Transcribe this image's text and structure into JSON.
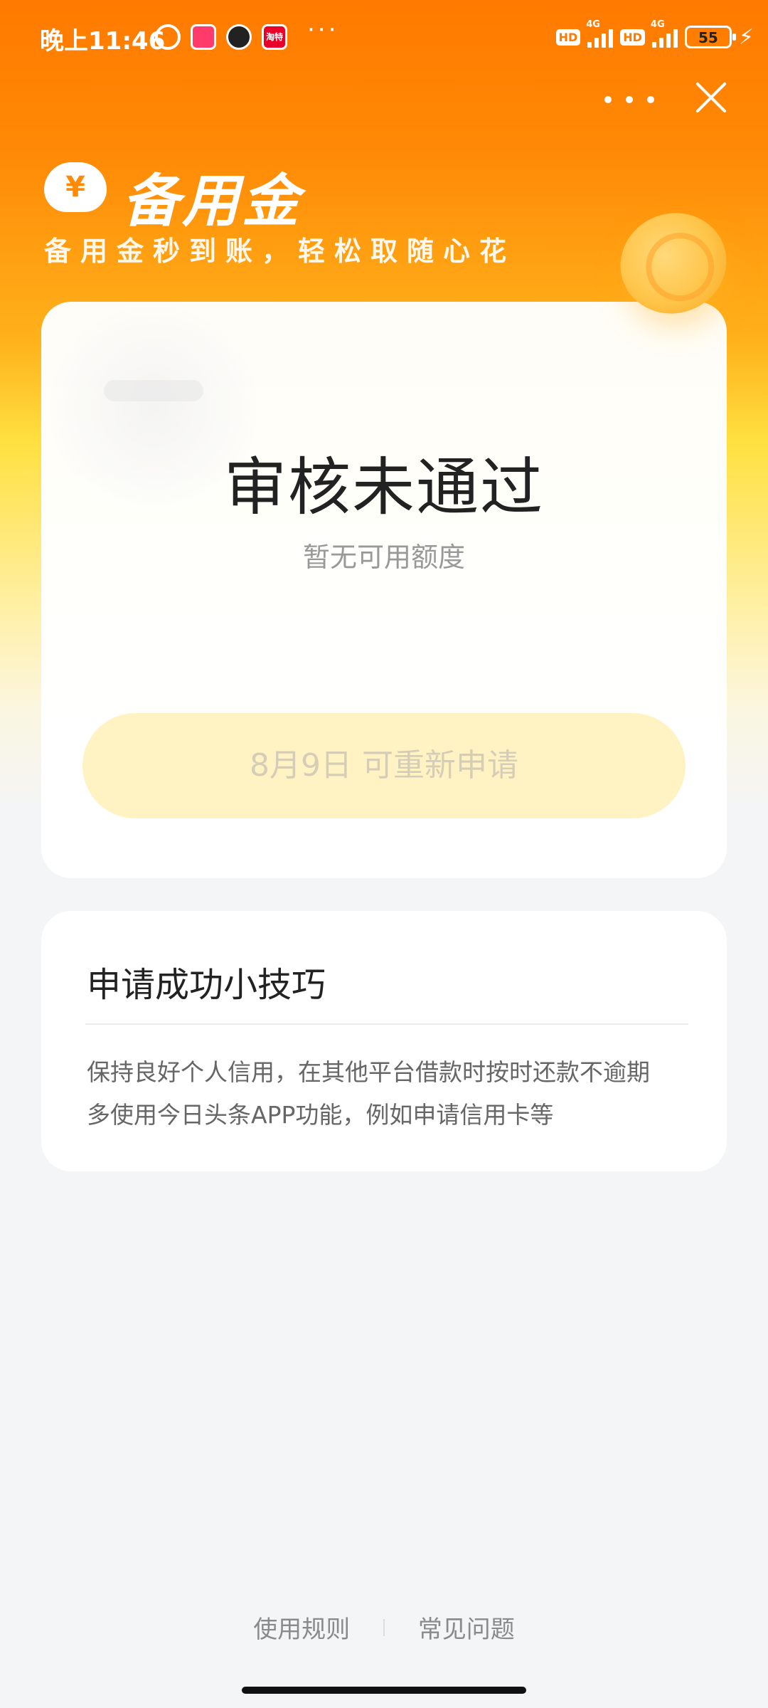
{
  "status_bar": {
    "time": "晚上11:46",
    "more": "···",
    "network_tags": [
      "HD",
      "4G",
      "HD",
      "4G"
    ],
    "battery_level": "55",
    "app_icon_label": "淘特"
  },
  "header": {
    "logo_symbol": "¥",
    "title": "备用金",
    "subtitle": "备用金秒到账，轻松取随心花"
  },
  "main_card": {
    "status_title": "审核未通过",
    "status_desc": "暂无可用额度",
    "reapply_button": "8月9日 可重新申请"
  },
  "tips_card": {
    "title": "申请成功小技巧",
    "lines": [
      "保持良好个人信用，在其他平台借款时按时还款不逾期",
      "多使用今日头条APP功能，例如申请信用卡等"
    ]
  },
  "footer": {
    "rules_link": "使用规则",
    "faq_link": "常见问题"
  },
  "colors": {
    "brand_orange": "#ff7a00",
    "button_bg": "#fff3c4",
    "button_text_disabled": "#d6cdb6"
  }
}
